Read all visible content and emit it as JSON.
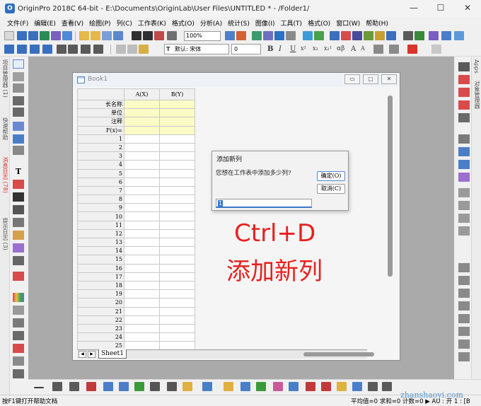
{
  "window": {
    "title": "OriginPro 2018C 64-bit - E:\\Documents\\OriginLab\\User Files\\UNTITLED * - /Folder1/",
    "controls": [
      "—",
      "☐",
      "✕"
    ]
  },
  "menu": [
    "文件(F)",
    "编辑(E)",
    "查看(V)",
    "绘图(P)",
    "列(C)",
    "工作表(K)",
    "格式(O)",
    "分析(A)",
    "统计(S)",
    "图像(I)",
    "工具(T)",
    "格式(O)",
    "窗口(W)",
    "帮助(H)"
  ],
  "toolbar": {
    "zoom": "100%",
    "font_name": "默认: 宋体",
    "font_size": "0",
    "format_letters": [
      "B",
      "I",
      "U",
      "x²",
      "x₂",
      "x₂¹",
      "αβ",
      "A",
      "A"
    ]
  },
  "left_tabs": [
    "项目管理器 (1)",
    "快速帮助",
    "消息日志 (78)",
    "提示日志 (3)"
  ],
  "right_tabs": [
    "Apps",
    "对象管理器"
  ],
  "book": {
    "title": "Book1",
    "buttons": [
      "▭",
      "▢",
      "✕"
    ],
    "columns": [
      "A(X)",
      "B(Y)"
    ],
    "header_rows": [
      "长名称",
      "单位",
      "注释",
      "F(x)="
    ],
    "row_numbers": [
      "1",
      "2",
      "3",
      "4",
      "5",
      "6",
      "7",
      "8",
      "9",
      "10",
      "11",
      "12",
      "13",
      "14",
      "15",
      "16",
      "17",
      "18",
      "19",
      "20",
      "21",
      "22",
      "23",
      "24",
      "25"
    ],
    "sheet_tab": "Sheet1"
  },
  "dialog": {
    "title": "添加新列",
    "prompt": "您想在工作表中添加多少列?",
    "ok": "确定(O)",
    "cancel": "取消(C)",
    "value": "1"
  },
  "overlay": {
    "line1": "Ctrl+D",
    "line2": "添加新列",
    "color": "#e8201e"
  },
  "status": {
    "left": "按F1键打开帮助文档",
    "right": "平均值=0 求和=0 计数=0 ▶  AU : 开  1 : [B"
  },
  "watermark": "zhanshaoyi.com"
}
